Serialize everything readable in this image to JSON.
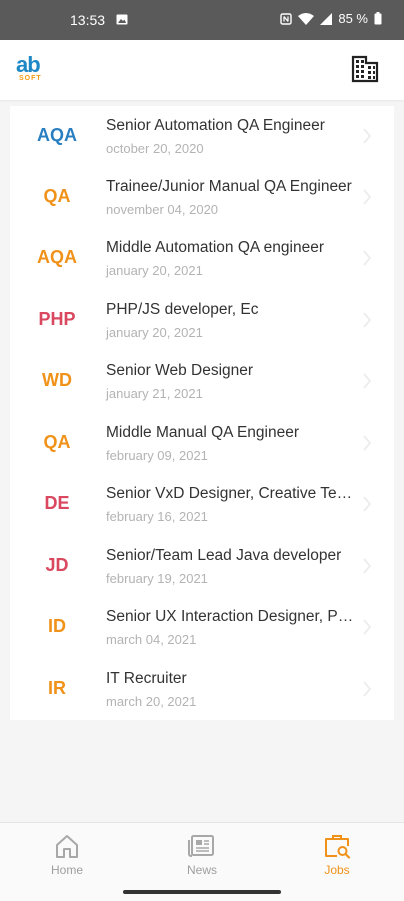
{
  "status_bar": {
    "time": "13:53",
    "battery": "85 %"
  },
  "app_bar": {
    "logo_top": "ab",
    "logo_bottom": "SOFT",
    "brand_colors": {
      "ab": "#1e88c7",
      "soft": "#f39c12"
    },
    "right_icon": "office-building-icon"
  },
  "jobs": [
    {
      "abbr": "AQA",
      "abbr_color": "#2a7fc1",
      "title": "Senior Automation QA Engineer",
      "date": "october 20, 2020"
    },
    {
      "abbr": "QA",
      "abbr_color": "#f0921a",
      "title": "Trainee/Junior Manual QA Engineer",
      "date": "november 04, 2020"
    },
    {
      "abbr": "AQA",
      "abbr_color": "#f0921a",
      "title": "Middle Automation QA engineer",
      "date": "january 20, 2021"
    },
    {
      "abbr": "PHP",
      "abbr_color": "#d9485f",
      "title": "PHP/JS developer, Ec",
      "date": "january 20, 2021"
    },
    {
      "abbr": "WD",
      "abbr_color": "#f0921a",
      "title": "Senior Web Designer",
      "date": "january 21, 2021"
    },
    {
      "abbr": "QA",
      "abbr_color": "#f0921a",
      "title": "Middle Manual QA Engineer",
      "date": "february 09, 2021"
    },
    {
      "abbr": "DE",
      "abbr_color": "#d9485f",
      "title": "Senior VxD Designer, Creative Team",
      "date": "february 16, 2021"
    },
    {
      "abbr": "JD",
      "abbr_color": "#d9485f",
      "title": "Senior/Team Lead Java developer",
      "date": "february 19, 2021"
    },
    {
      "abbr": "ID",
      "abbr_color": "#f0921a",
      "title": "Senior UX Interaction Designer, Product",
      "date": "march 04, 2021"
    },
    {
      "abbr": "IR",
      "abbr_color": "#f0921a",
      "title": "IT Recruiter",
      "date": "march 20, 2021"
    }
  ],
  "bottom_nav": {
    "items": [
      {
        "label": "Home",
        "icon": "home-icon",
        "active": false
      },
      {
        "label": "News",
        "icon": "newspaper-icon",
        "active": false
      },
      {
        "label": "Jobs",
        "icon": "briefcase-search-icon",
        "active": true
      }
    ],
    "active_color": "#f0921a",
    "inactive_color": "#9e9e9e"
  }
}
